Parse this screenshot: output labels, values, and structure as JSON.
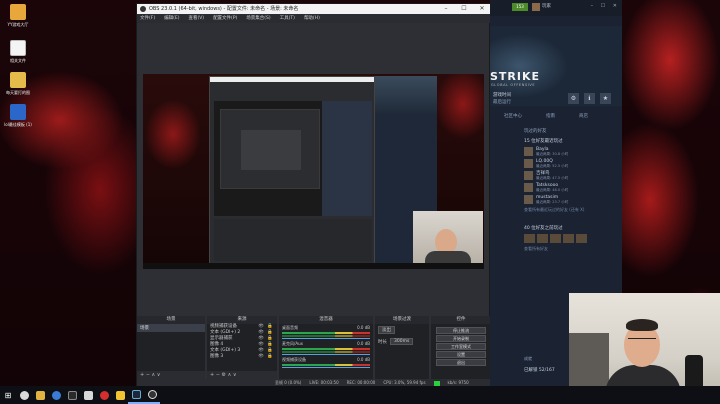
{
  "desktop": {
    "icons": [
      {
        "label": "YY游戏大厅",
        "icon": "app-cat-icon"
      },
      {
        "label": "相关文件",
        "icon": "file-icon"
      },
      {
        "label": "每天要打的图",
        "icon": "folder-icon"
      },
      {
        "label": "lol最佳模板 (1)",
        "icon": "doc-icon"
      }
    ]
  },
  "obs": {
    "title": "OBS 23.0.1 (64-bit, windows) - 配置文件: 未命名 - 场景: 未命名",
    "window_buttons": [
      "–",
      "☐",
      "✕"
    ],
    "menu": [
      "文件(F)",
      "编辑(E)",
      "查看(V)",
      "配置文件(P)",
      "场景集合(S)",
      "工具(T)",
      "帮助(H)"
    ],
    "docks": {
      "scenes": {
        "title": "场景",
        "items": [
          "场景"
        ],
        "footer": "+ − ∧ ∨"
      },
      "sources": {
        "title": "来源",
        "items": [
          "视频捕获设备",
          "文本 (GDI+) 2",
          "显示器捕获",
          "图像 4",
          "文本 (GDI+) 3",
          "图像 3"
        ],
        "toggle": "👁 🔒",
        "footer": "+ − ⚙ ∧ ∨"
      },
      "mixer": {
        "title": "混音器",
        "channels": [
          {
            "name": "桌面音频",
            "db": "0.0 dB"
          },
          {
            "name": "麦克风/Aux",
            "db": "0.0 dB"
          },
          {
            "name": "视频捕获设备",
            "db": "0.0 dB"
          }
        ]
      },
      "transitions": {
        "title": "场景过渡",
        "type": "淡出",
        "duration_label": "时长",
        "duration": "300ms"
      },
      "controls": {
        "title": "控件",
        "buttons": [
          "停止推流",
          "开始录制",
          "工作室模式",
          "设置",
          "退出"
        ]
      }
    },
    "status": {
      "dropped": "丢帧 0 (0.0%)",
      "live": "LIVE: 00:03:50",
      "rec": "REC: 00:00:00",
      "cpu": "CPU: 3.0%, 59.94 fps",
      "bitrate": "kb/s: 9750"
    }
  },
  "steam": {
    "badge": "153",
    "username": "玩家",
    "window_buttons": "– ☐ ✕",
    "game_title": "STRIKE",
    "game_subtitle": "GLOBAL OFFENSIVE",
    "play_time_label": "游戏时间",
    "play_time_value": "最后运行",
    "icons": [
      "⚙",
      "ℹ",
      "★"
    ],
    "tabs": [
      "社区中心",
      "指南",
      "商店"
    ],
    "friends_header": "玩过的好友",
    "friends_recent": "15 位好友最近玩过",
    "friends": [
      {
        "name": "Bayla",
        "status": "最近两周: 30.8 小时"
      },
      {
        "name": "LQ.00Q",
        "status": "最近两周: 52.5 小时"
      },
      {
        "name": "吉祥鸟",
        "status": "最近两周: 47.5 小时"
      },
      {
        "name": "Tatsksooo",
        "status": "最近两周: 48.0 小时"
      },
      {
        "name": "mustasim",
        "status": "最近两周: 23.7 小时"
      }
    ],
    "friends_more": "查看所有最近玩过的好友 (还有 X)",
    "friends_long": "40 位好友之前玩过",
    "friends_all": "查看所有好友",
    "bottom_label": "成就",
    "bottom_value": "已解锁 52/167"
  },
  "taskbar": {
    "icons": [
      "start-icon",
      "search-icon",
      "explorer-icon",
      "browser-icon",
      "media-icon",
      "mail-icon",
      "netease-icon",
      "files-icon",
      "steam-icon",
      "obs-icon"
    ]
  }
}
